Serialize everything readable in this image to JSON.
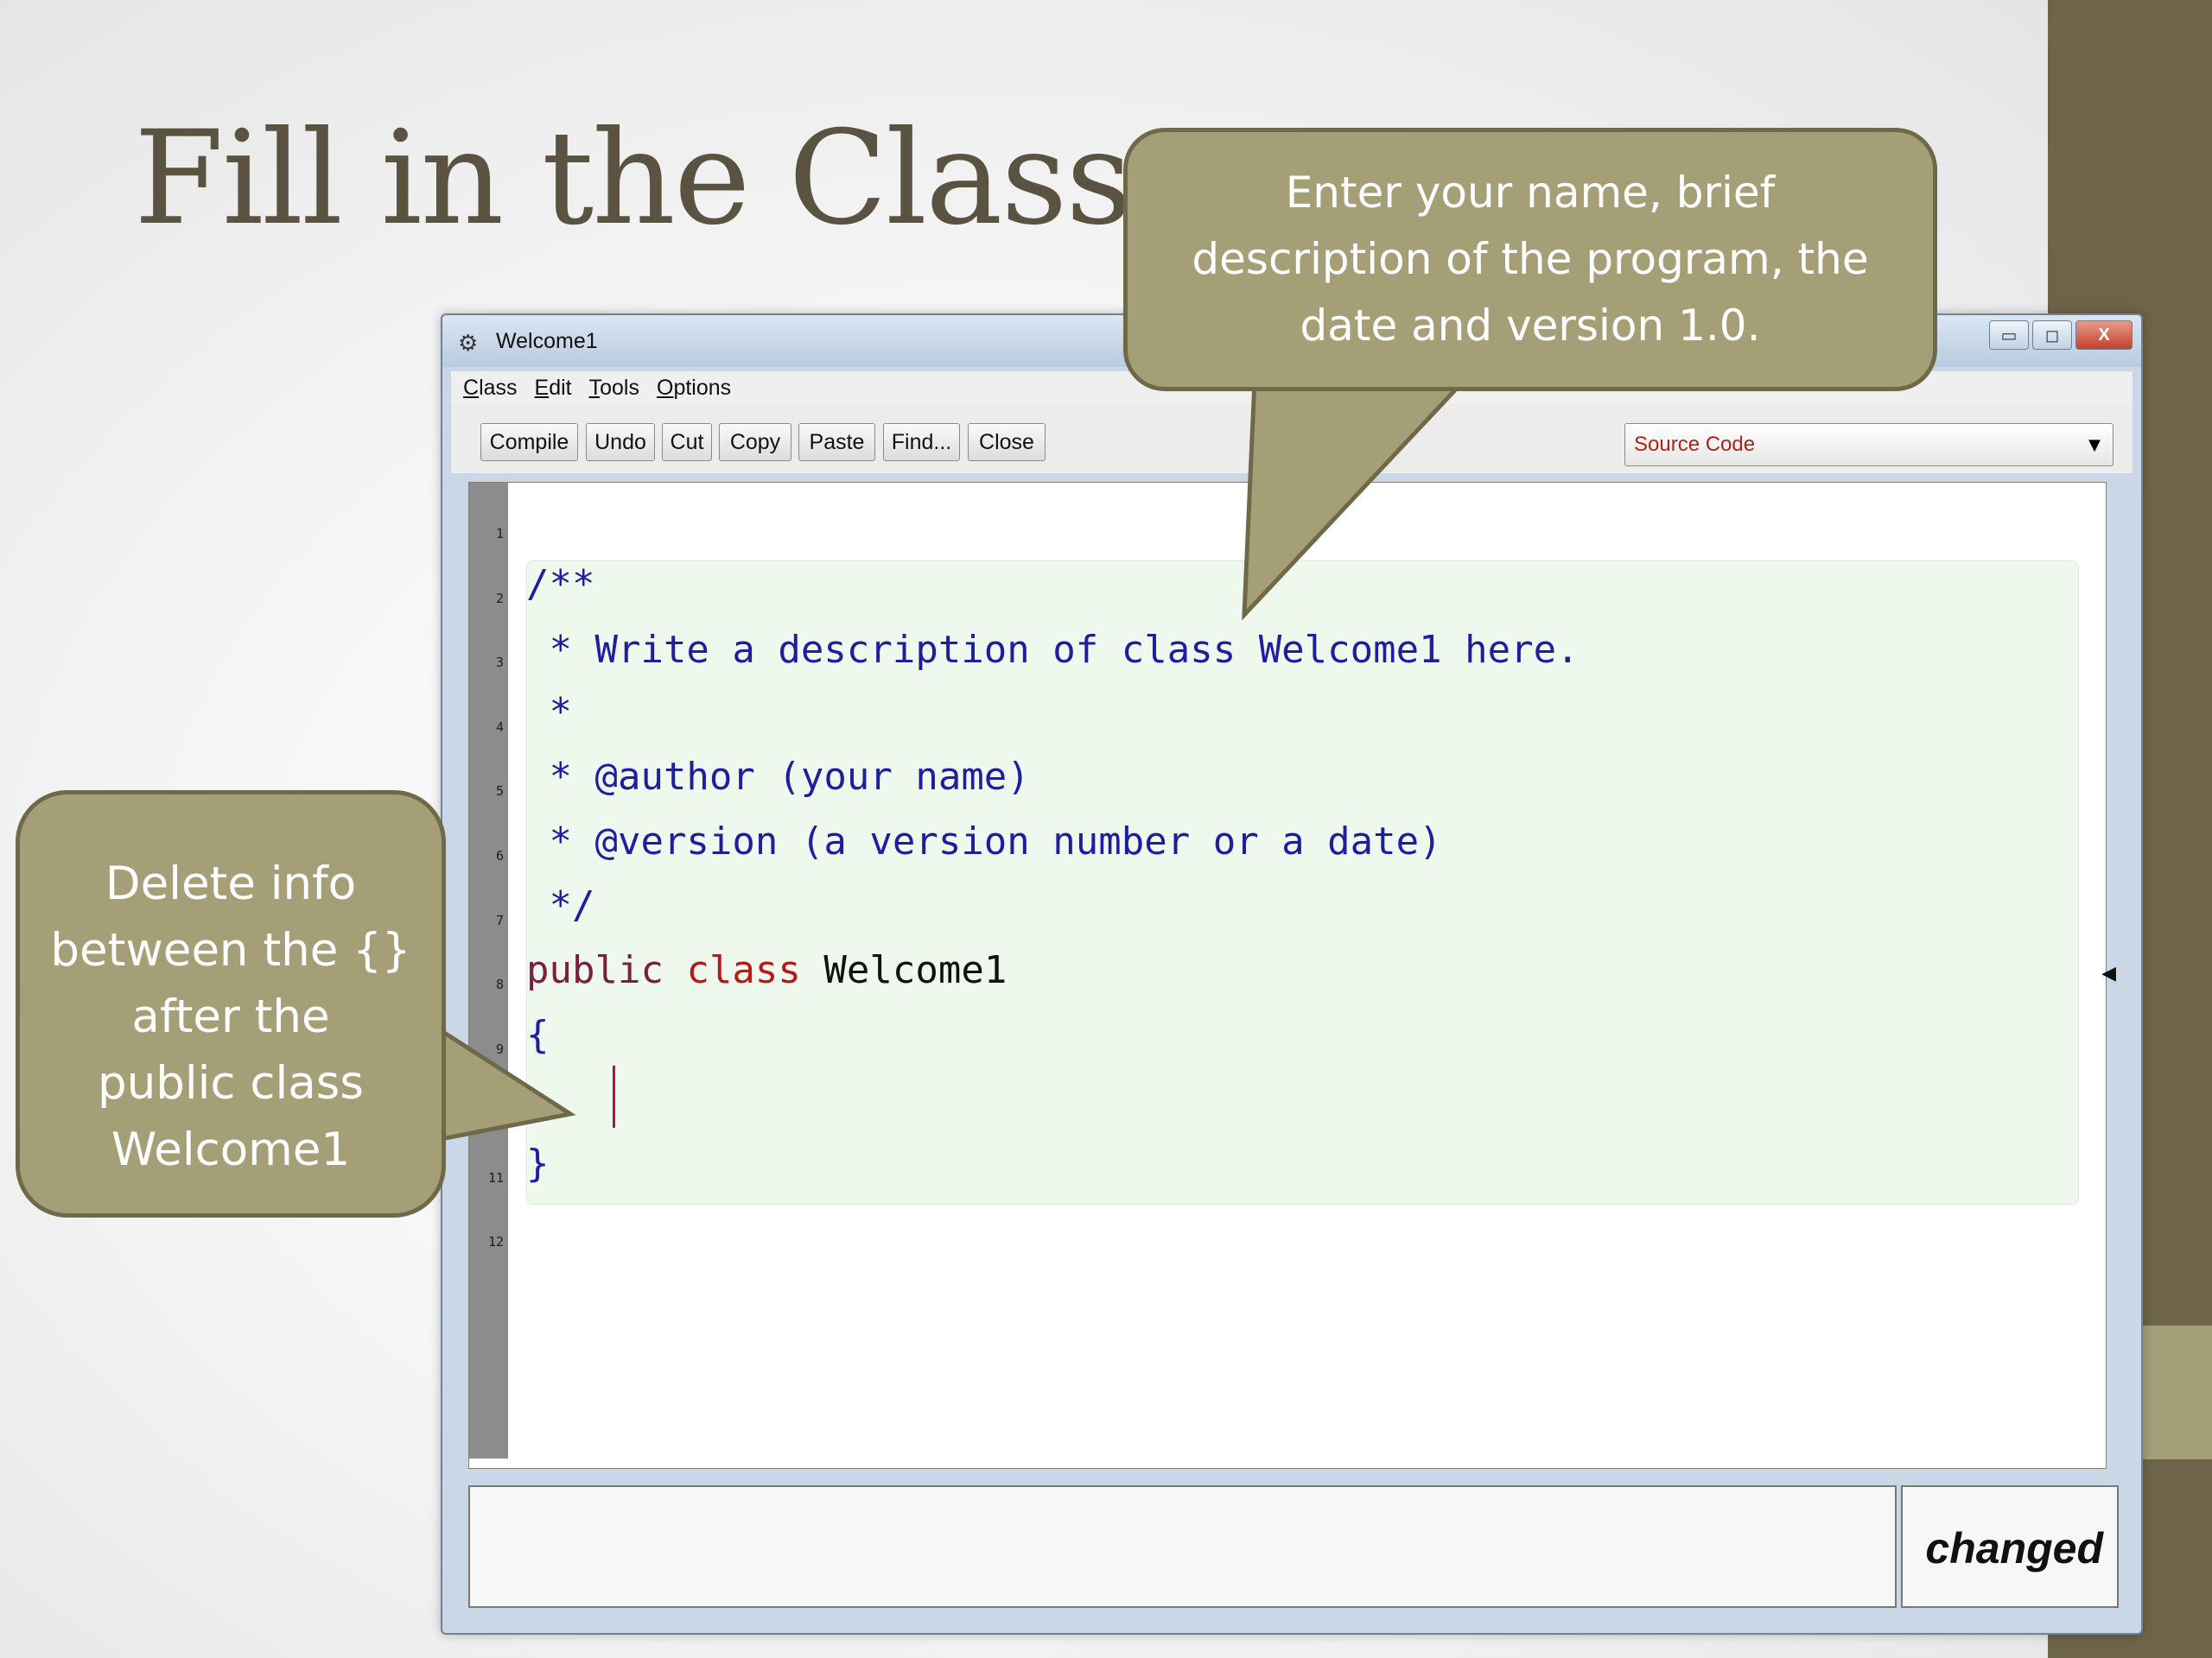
{
  "slide": {
    "title": "Fill in the Class",
    "colors": {
      "accent_dark": "#6e6449",
      "accent_light": "#a59f78",
      "title": "#5b5341"
    }
  },
  "callouts": {
    "top": {
      "lines": [
        "Enter your name, brief",
        "description of the program, the",
        "date and version 1.0."
      ]
    },
    "left": {
      "lines": [
        "Delete info",
        "between the {}",
        "after the",
        "public class",
        "Welcome1"
      ]
    }
  },
  "window": {
    "title": "Welcome1",
    "controls": {
      "minimize": "▭",
      "maximize": "◻",
      "close": "X"
    },
    "menu": [
      "Class",
      "Edit",
      "Tools",
      "Options"
    ],
    "toolbar": [
      "Compile",
      "Undo",
      "Cut",
      "Copy",
      "Paste",
      "Find...",
      "Close"
    ],
    "view_select": {
      "value": "Source Code"
    },
    "editor": {
      "line_numbers": [
        "1",
        "2",
        "3",
        "4",
        "5",
        "6",
        "7",
        "8",
        "9",
        "11",
        "12"
      ],
      "lines": {
        "l2": "/**",
        "l3": " * Write a description of class Welcome1 here.",
        "l4": " *",
        "l5": " * @author (your name)",
        "l6": " * @version (a version number or a date)",
        "l7": " */",
        "l8_kw_public": "public",
        "l8_kw_class": "class",
        "l8_name": "Welcome1",
        "l9": "{",
        "l11": "}"
      }
    },
    "status": "changed"
  }
}
